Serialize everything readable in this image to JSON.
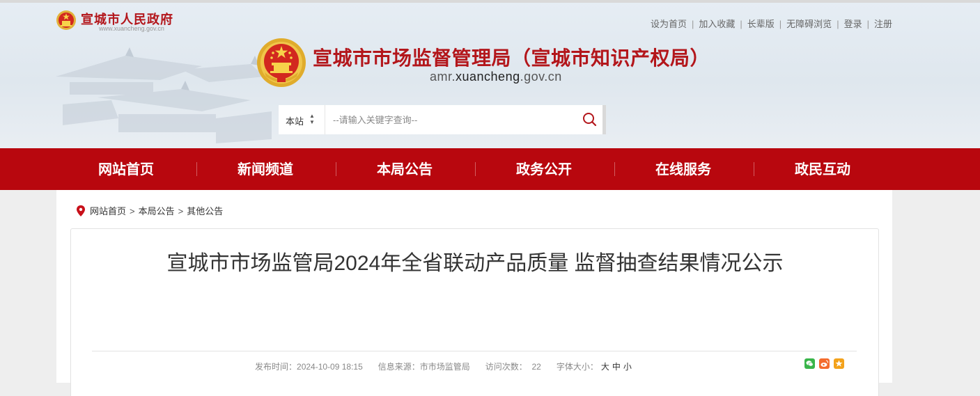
{
  "header": {
    "gov_name": "宣城市人民政府",
    "gov_url": "www.xuancheng.gov.cn",
    "toplinks": [
      "设为首页",
      "加入收藏",
      "长辈版",
      "无障碍浏览",
      "登录",
      "注册"
    ],
    "agency_title": "宣城市市场监督管理局（宣城市知识产权局）",
    "agency_url_prefix": "amr.",
    "agency_url_mid": "xuancheng",
    "agency_url_suffix": ".gov.cn"
  },
  "search": {
    "scope_label": "本站",
    "placeholder": "--请输入关键字查询--"
  },
  "nav": {
    "items": [
      "网站首页",
      "新闻频道",
      "本局公告",
      "政务公开",
      "在线服务",
      "政民互动"
    ]
  },
  "breadcrumb": {
    "items": [
      "网站首页",
      "本局公告",
      "其他公告"
    ],
    "separator": ">"
  },
  "article": {
    "title": "宣城市市场监管局2024年全省联动产品质量 监督抽查结果情况公示",
    "published_label": "发布时间：",
    "published_value": "2024-10-09 18:15",
    "source_label": "信息来源：",
    "source_value": "市市场监管局",
    "visits_label": "访问次数：",
    "visits_value": "22",
    "fontsize_label": "字体大小：",
    "fontsize_options": [
      "大",
      "中",
      "小"
    ]
  },
  "share_icons": [
    "wechat-icon",
    "weibo-icon",
    "favorite-icon"
  ],
  "colors": {
    "brand_red": "#b8070e",
    "title_red": "#b3161b",
    "wechat_green": "#39b54a",
    "weibo_orange": "#f46b2c",
    "favorite_orange": "#f3a21b"
  }
}
